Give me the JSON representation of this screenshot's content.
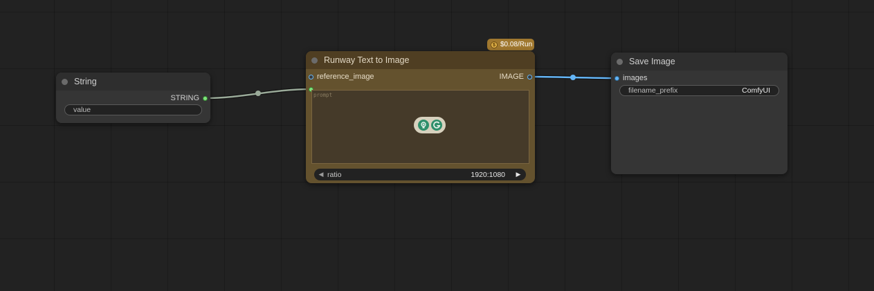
{
  "nodes": {
    "string": {
      "title": "String",
      "output_label": "STRING",
      "widget_name": "value",
      "widget_value": ""
    },
    "runway": {
      "title": "Runway Text to Image",
      "price": "$0.08/Run",
      "coin_symbol": "$",
      "input_label": "reference_image",
      "output_label": "IMAGE",
      "prompt_placeholder": "prompt",
      "combo": {
        "name": "ratio",
        "value": "1920:1080",
        "left_arrow": "◀",
        "right_arrow": "▶"
      }
    },
    "save": {
      "title": "Save Image",
      "input_label": "images",
      "widget_name": "filename_prefix",
      "widget_value": "ComfyUI"
    }
  },
  "colors": {
    "canvas_bg": "#222222",
    "image_link": "#64b5f6",
    "string_link": "#9aaa99",
    "runway_body": "#64522e",
    "runway_header": "#4f3e22",
    "price_badge": "#a0782f",
    "default_node": "#353535"
  },
  "icons": [
    "coin-icon",
    "lightbulb-icon",
    "grammar-check-icon"
  ]
}
